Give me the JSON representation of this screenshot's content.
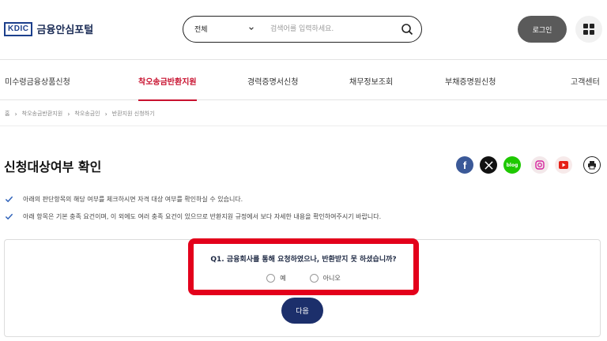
{
  "header": {
    "logo_badge": "KDIC",
    "logo_text": "금융안심포털",
    "search_select": "전체",
    "search_placeholder": "검색어를 입력하세요.",
    "login_label": "로그인"
  },
  "nav": {
    "items": [
      {
        "label": "미수령금융상품신청"
      },
      {
        "label": "착오송금반환지원"
      },
      {
        "label": "경력증명서신청"
      },
      {
        "label": "채무정보조회"
      },
      {
        "label": "부채증명원신청"
      },
      {
        "label": "고객센터"
      }
    ],
    "active_index": 1
  },
  "breadcrumb": {
    "home": "홈",
    "items": [
      "착오송금반환지원",
      "착오송금인",
      "반환지원 신청하기"
    ]
  },
  "page": {
    "title": "신청대상여부 확인",
    "notes": [
      "아래의 판단항목의 해당 여부를 체크하시면 자격 대상 여부를 확인하실 수 있습니다.",
      "아래 항목은 기본 충족 요건이며, 이 외에도 여러 충족 요건이 있으므로 반환지원 규정에서 보다 자세한 내용을 확인하여주시기 바랍니다."
    ]
  },
  "share": {
    "icons": [
      "facebook-icon",
      "x-icon",
      "blog-icon",
      "instagram-icon",
      "youtube-icon",
      "print-icon"
    ],
    "blog_label": "blog"
  },
  "question": {
    "text": "Q1. 금융회사를 통해 요청하였으나, 반환받지 못 하셨습니까?",
    "options": [
      "예",
      "아니오"
    ],
    "next_label": "다음"
  },
  "colors": {
    "accent_red": "#c8102e",
    "highlight_red": "#e3001b",
    "navy": "#1c2f6b",
    "login_gray": "#5a5a5a",
    "facebook": "#3b5998",
    "blog_green": "#1ec800",
    "youtube_red": "#e62117"
  }
}
